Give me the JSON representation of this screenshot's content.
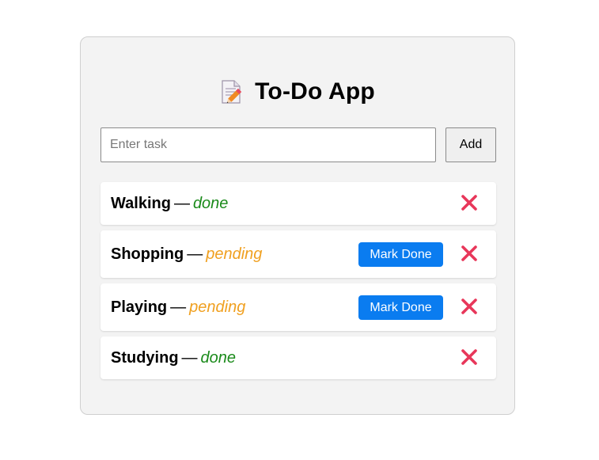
{
  "app": {
    "title": "To-Do App",
    "title_icon": "memo-pencil-icon"
  },
  "new_task": {
    "placeholder": "Enter task",
    "value": "",
    "add_label": "Add"
  },
  "tasks": [
    {
      "name": "Walking",
      "separator": "—",
      "status": "done"
    },
    {
      "name": "Shopping",
      "separator": "—",
      "status": "pending",
      "action_label": "Mark Done"
    },
    {
      "name": "Playing",
      "separator": "—",
      "status": "pending",
      "action_label": "Mark Done"
    },
    {
      "name": "Studying",
      "separator": "—",
      "status": "done"
    }
  ],
  "colors": {
    "done": "#1a8a1a",
    "pending": "#f0a020",
    "primary": "#0a7cf0",
    "delete": "#e8375a"
  }
}
